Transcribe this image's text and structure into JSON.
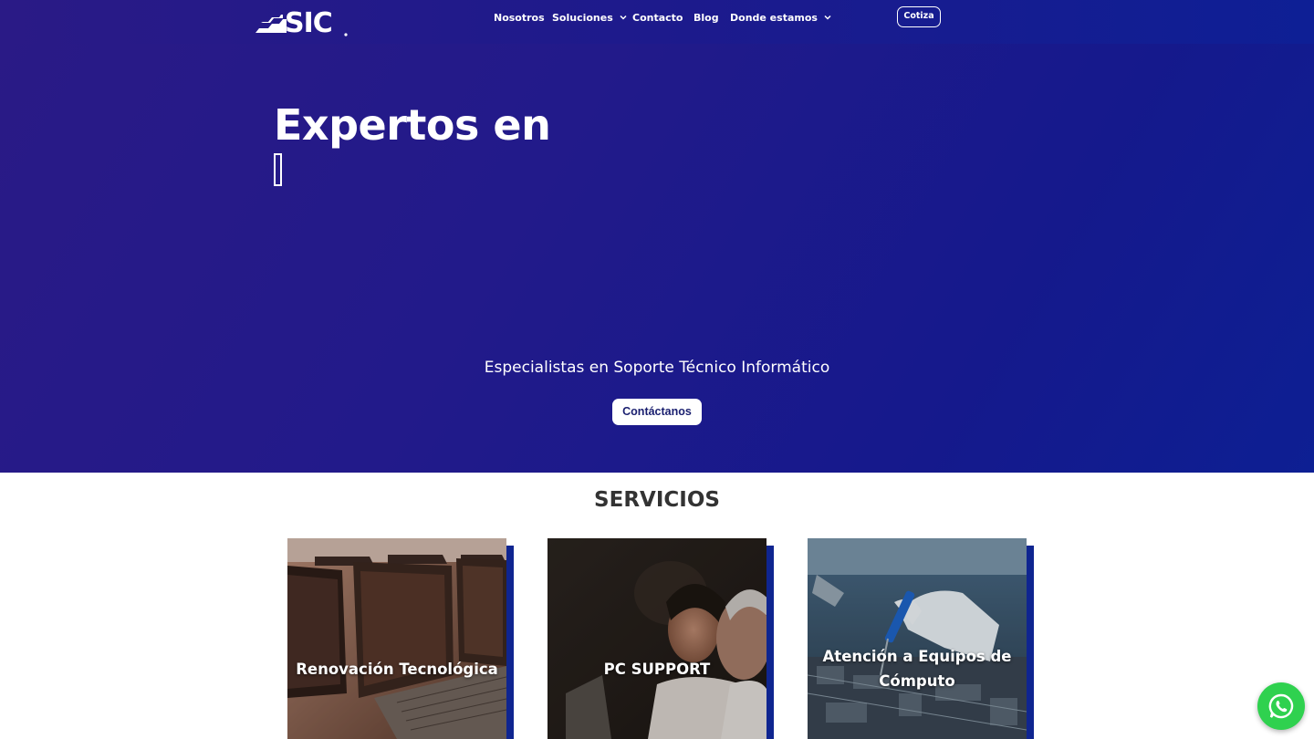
{
  "header": {
    "logo_text": "SIC",
    "nav": [
      {
        "label": "Nosotros",
        "has_dropdown": false
      },
      {
        "label": "Soluciones",
        "has_dropdown": true
      },
      {
        "label": "Contacto",
        "has_dropdown": false
      },
      {
        "label": "Blog",
        "has_dropdown": false
      },
      {
        "label": "Donde estamos",
        "has_dropdown": true
      }
    ],
    "cta_label": "Cotiza"
  },
  "hero": {
    "title": "Expertos en",
    "subtitle": "Especialistas en Soporte Técnico Informático",
    "button_label": "Contáctanos"
  },
  "services": {
    "title": "SERVICIOS",
    "cards": [
      {
        "label": "Renovación Tecnológica",
        "image": "laptops-row-photo"
      },
      {
        "label": "PC SUPPORT",
        "image": "support-agents-photo"
      },
      {
        "label_line1": "Atención a Equipos de",
        "label_line2": "Cómputo",
        "image": "soldering-repair-photo"
      }
    ]
  },
  "colors": {
    "hero_gradient_start": "#2a1a86",
    "hero_gradient_end": "#0d1f93",
    "card_accent": "#0f2590",
    "whatsapp_green": "#2fd14f"
  },
  "floating": {
    "icon": "whatsapp-icon"
  }
}
